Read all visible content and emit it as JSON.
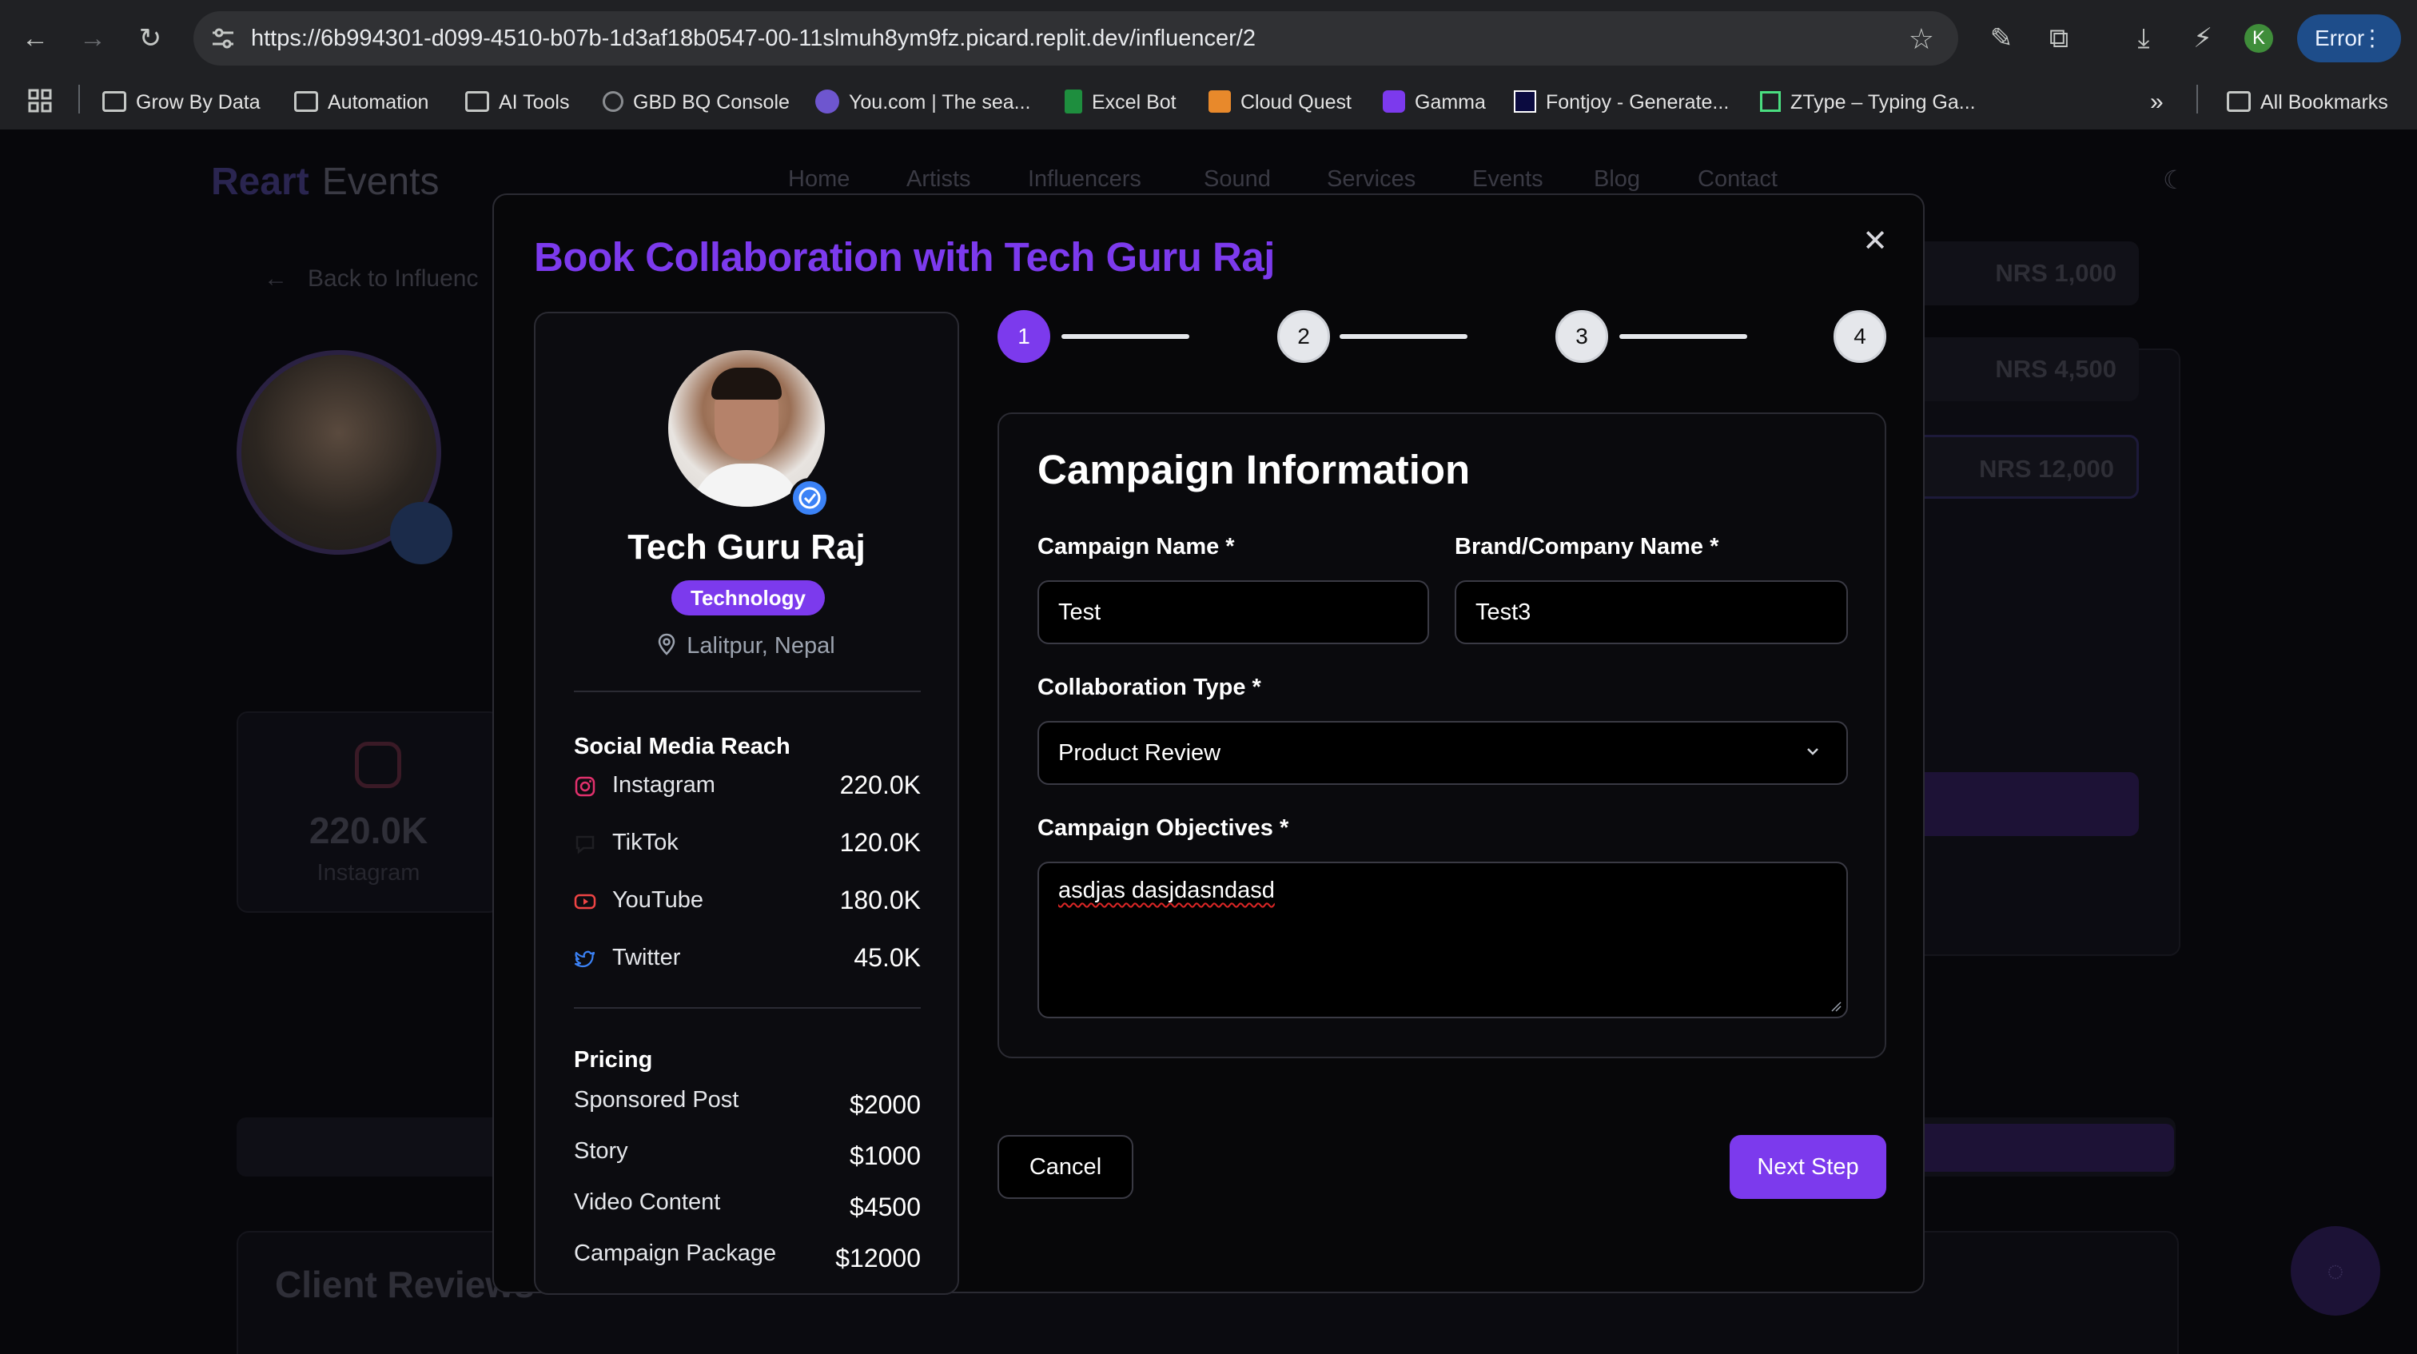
{
  "browser": {
    "url": "https://6b994301-d099-4510-b07b-1d3af18b0547-00-11slmuh8ym9fz.picard.replit.dev/influencer/2",
    "profile_initial": "K",
    "error_label": "Error",
    "bookmarks": [
      {
        "label": "Grow By Data",
        "icon": "folder-icon"
      },
      {
        "label": "Automation",
        "icon": "folder-icon"
      },
      {
        "label": "AI Tools",
        "icon": "folder-icon"
      },
      {
        "label": "GBD BQ Console",
        "icon": "bigquery-icon"
      },
      {
        "label": "You.com | The sea...",
        "icon": "you-com-icon"
      },
      {
        "label": "Excel Bot",
        "icon": "sheet-icon"
      },
      {
        "label": "Cloud Quest",
        "icon": "cube-icon"
      },
      {
        "label": "Gamma",
        "icon": "gamma-icon"
      },
      {
        "label": "Fontjoy - Generate...",
        "icon": "fontjoy-icon"
      },
      {
        "label": "ZType – Typing Ga...",
        "icon": "ztype-icon"
      }
    ],
    "more_bookmarks": "»",
    "all_bookmarks": "All Bookmarks"
  },
  "site": {
    "logo_main": "Reart",
    "logo_sub": "Events",
    "nav": [
      "Home",
      "Artists",
      "Influencers",
      "Sound",
      "Services",
      "Events",
      "Blog",
      "Contact"
    ],
    "back_link": "Back to Influenc",
    "stat_value": "220.0K",
    "stat_label": "Instagram",
    "price_pills": [
      "NRS 1,000",
      "NRS 4,500",
      "NRS 12,000"
    ],
    "reviews_title": "Client Reviews"
  },
  "modal": {
    "title": "Book Collaboration with Tech Guru Raj",
    "profile": {
      "name": "Tech Guru Raj",
      "category": "Technology",
      "location": "Lalitpur, Nepal",
      "social_heading": "Social Media Reach",
      "social": [
        {
          "platform": "Instagram",
          "value": "220.0K",
          "icon": "instagram-icon",
          "color": "#e1306c"
        },
        {
          "platform": "TikTok",
          "value": "120.0K",
          "icon": "tiktok-icon",
          "color": "#111111"
        },
        {
          "platform": "YouTube",
          "value": "180.0K",
          "icon": "youtube-icon",
          "color": "#ef4444"
        },
        {
          "platform": "Twitter",
          "value": "45.0K",
          "icon": "twitter-icon",
          "color": "#3b82f6"
        }
      ],
      "pricing_heading": "Pricing",
      "pricing": [
        {
          "item": "Sponsored Post",
          "price": "$2000"
        },
        {
          "item": "Story",
          "price": "$1000"
        },
        {
          "item": "Video Content",
          "price": "$4500"
        },
        {
          "item": "Campaign Package",
          "price": "$12000"
        }
      ]
    },
    "steps": [
      "1",
      "2",
      "3",
      "4"
    ],
    "active_step": 1,
    "form": {
      "title": "Campaign Information",
      "campaign_name_label": "Campaign Name *",
      "campaign_name_value": "Test",
      "brand_label": "Brand/Company Name *",
      "brand_value": "Test3",
      "collab_type_label": "Collaboration Type *",
      "collab_type_value": "Product Review",
      "objectives_label": "Campaign Objectives *",
      "objectives_value": "asdjas dasjdasndasd"
    },
    "cancel_label": "Cancel",
    "next_label": "Next Step"
  },
  "colors": {
    "accent": "#7c3aed",
    "verify_blue": "#3b82f6"
  }
}
